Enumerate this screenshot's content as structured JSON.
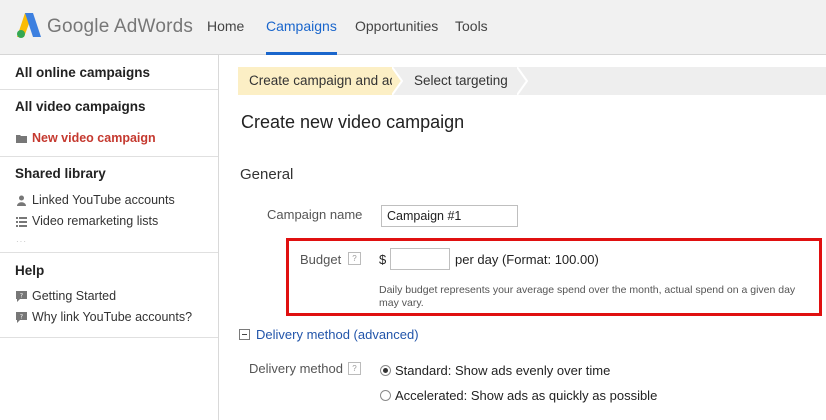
{
  "brand": {
    "logo_text": "Google AdWords",
    "colors": {
      "blue": "#3d80e0",
      "green": "#34a853",
      "yellow": "#fbbc05",
      "accent": "#1a66cc",
      "highlight": "#e01010"
    }
  },
  "nav": {
    "home": "Home",
    "campaigns": "Campaigns",
    "opportunities": "Opportunities",
    "tools": "Tools"
  },
  "sidebar": {
    "all_online": "All online campaigns",
    "all_video": "All video campaigns",
    "new_video": "New video campaign",
    "shared_library": "Shared library",
    "linked_youtube": "Linked YouTube accounts",
    "remarketing": "Video remarketing lists",
    "help": "Help",
    "getting_started": "Getting Started",
    "why_link": "Why link YouTube accounts?",
    "icons": {
      "new_video": "folder-icon",
      "linked_youtube": "person-icon",
      "remarketing": "list-icon",
      "getting_started": "help-bubble-icon",
      "why_link": "help-bubble-icon"
    }
  },
  "steps": {
    "step1": "Create campaign and ad",
    "step2": "Select targeting"
  },
  "page": {
    "title": "Create new video campaign",
    "general": "General"
  },
  "form": {
    "campaign_name_label": "Campaign name",
    "campaign_name_value": "Campaign #1",
    "budget_label": "Budget",
    "help_glyph": "?",
    "currency": "$",
    "budget_value": "",
    "per_day": "per day (Format: 100.00)",
    "budget_note": "Daily budget represents your average spend over the month, actual spend on a given day may vary.",
    "delivery_toggle": "Delivery method (advanced)",
    "delivery_label": "Delivery method",
    "standard": "Standard: Show ads evenly over time",
    "accelerated": "Accelerated: Show ads as quickly as possible",
    "selected_delivery": "standard"
  }
}
